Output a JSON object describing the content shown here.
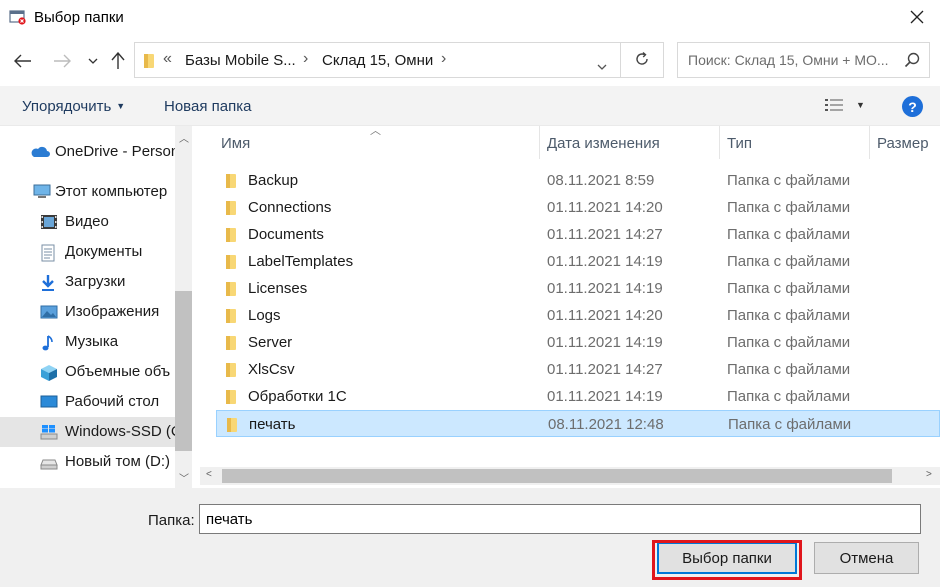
{
  "window": {
    "title": "Выбор папки",
    "icon": "folder-select-app-icon",
    "close_icon": "close-icon"
  },
  "address": {
    "crumbs": [
      "Базы Mobile S...",
      "Склад 15, Омни"
    ],
    "overflow": "«",
    "separator": "›",
    "search_placeholder": "Поиск: Склад 15, Омни + МО..."
  },
  "toolbar": {
    "organize_label": "Упорядочить",
    "new_folder_label": "Новая папка",
    "view_icon": "view-options-icon",
    "help_icon": "help-icon",
    "help_label": "?"
  },
  "nav": {
    "items": [
      {
        "label": "OneDrive - Person",
        "icon": "onedrive-cloud-icon"
      },
      {
        "label": "Этот компьютер",
        "icon": "this-pc-icon"
      },
      {
        "label": "Видео",
        "icon": "video-icon"
      },
      {
        "label": "Документы",
        "icon": "documents-icon"
      },
      {
        "label": "Загрузки",
        "icon": "downloads-icon"
      },
      {
        "label": "Изображения",
        "icon": "pictures-icon"
      },
      {
        "label": "Музыка",
        "icon": "music-icon"
      },
      {
        "label": "Объемные объ",
        "icon": "3d-objects-icon"
      },
      {
        "label": "Рабочий стол",
        "icon": "desktop-icon"
      },
      {
        "label": "Windows-SSD (C",
        "icon": "windows-drive-icon",
        "selected": true
      },
      {
        "label": "Новый том (D:)",
        "icon": "drive-icon"
      }
    ]
  },
  "columns": {
    "name": "Имя",
    "date": "Дата изменения",
    "type": "Тип",
    "size": "Размер"
  },
  "files": [
    {
      "name": "Backup",
      "date": "08.11.2021 8:59",
      "type": "Папка с файлами"
    },
    {
      "name": "Connections",
      "date": "01.11.2021 14:20",
      "type": "Папка с файлами"
    },
    {
      "name": "Documents",
      "date": "01.11.2021 14:27",
      "type": "Папка с файлами"
    },
    {
      "name": "LabelTemplates",
      "date": "01.11.2021 14:19",
      "type": "Папка с файлами"
    },
    {
      "name": "Licenses",
      "date": "01.11.2021 14:19",
      "type": "Папка с файлами"
    },
    {
      "name": "Logs",
      "date": "01.11.2021 14:20",
      "type": "Папка с файлами"
    },
    {
      "name": "Server",
      "date": "01.11.2021 14:19",
      "type": "Папка с файлами"
    },
    {
      "name": "XlsCsv",
      "date": "01.11.2021 14:27",
      "type": "Папка с файлами"
    },
    {
      "name": "Обработки 1С",
      "date": "01.11.2021 14:19",
      "type": "Папка с файлами"
    },
    {
      "name": "печать",
      "date": "08.11.2021 12:48",
      "type": "Папка с файлами",
      "selected": true
    }
  ],
  "bottom": {
    "folder_label": "Папка:",
    "folder_value": "печать",
    "select_button": "Выбор папки",
    "cancel_button": "Отмена"
  },
  "colors": {
    "selection": "#cce8ff",
    "accent": "#0078d7",
    "highlight_frame": "#e0161c",
    "folder": "#f8d775"
  }
}
